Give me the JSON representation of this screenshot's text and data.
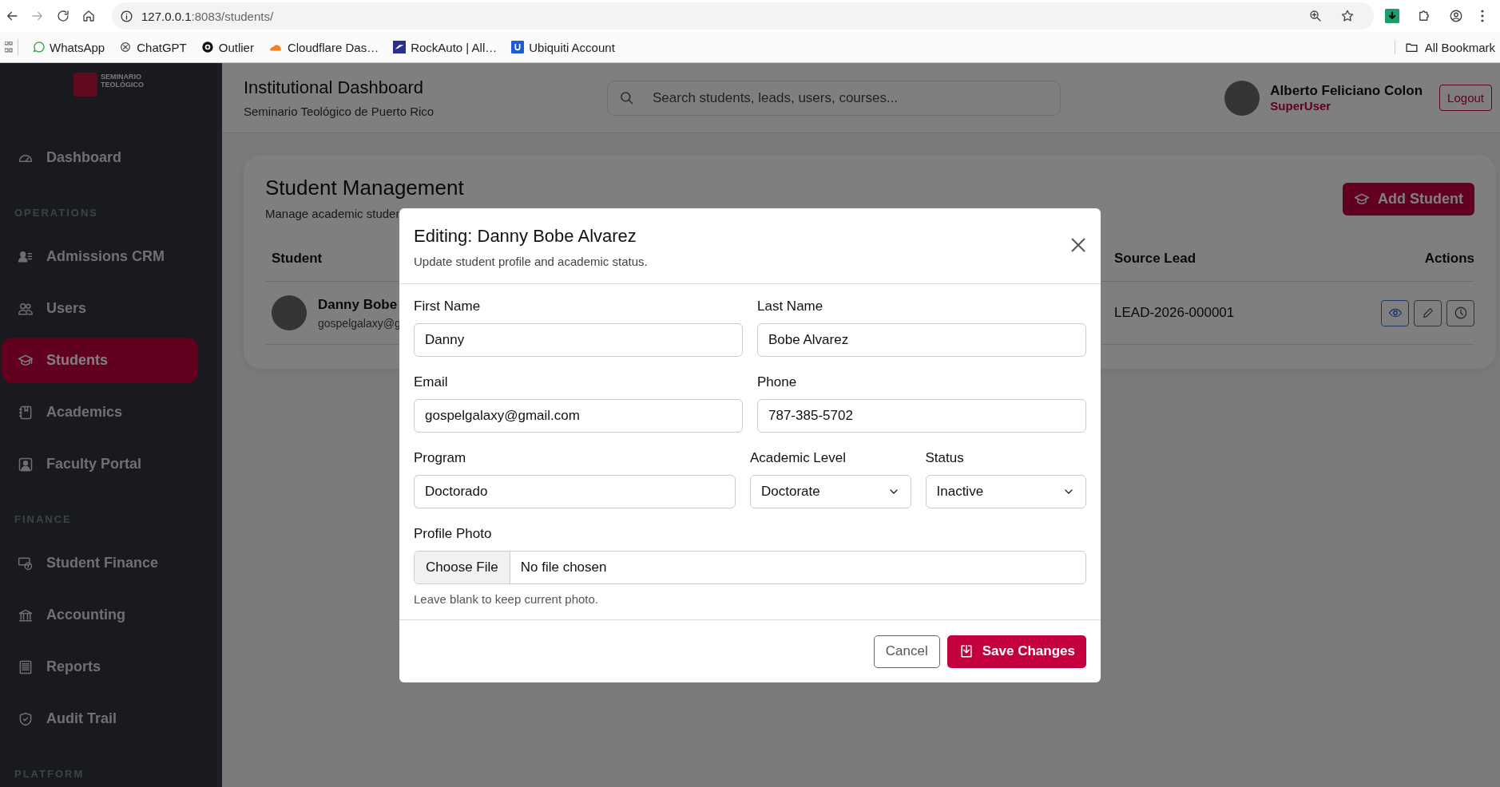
{
  "browser": {
    "url_host": "127.0.0.1",
    "url_path": ":8083/students/",
    "bookmarks": [
      {
        "label": "WhatsApp"
      },
      {
        "label": "ChatGPT"
      },
      {
        "label": "Outlier"
      },
      {
        "label": "Cloudflare Das…"
      },
      {
        "label": "RockAuto | All…"
      },
      {
        "label": "Ubiquiti Account"
      }
    ],
    "all_bookmarks": "All Bookmark"
  },
  "sidebar": {
    "logo_text": [
      "SEMINARIO",
      "TEOLÓGICO"
    ],
    "items": [
      {
        "kind": "link",
        "label": "Dashboard",
        "selected": false
      },
      {
        "kind": "section",
        "label": "OPERATIONS"
      },
      {
        "kind": "link",
        "label": "Admissions CRM",
        "selected": false
      },
      {
        "kind": "link",
        "label": "Users",
        "selected": false
      },
      {
        "kind": "link",
        "label": "Students",
        "selected": true
      },
      {
        "kind": "link",
        "label": "Academics",
        "selected": false
      },
      {
        "kind": "link",
        "label": "Faculty Portal",
        "selected": false
      },
      {
        "kind": "section",
        "label": "FINANCE"
      },
      {
        "kind": "link",
        "label": "Student Finance",
        "selected": false
      },
      {
        "kind": "link",
        "label": "Accounting",
        "selected": false
      },
      {
        "kind": "link",
        "label": "Reports",
        "selected": false
      },
      {
        "kind": "link",
        "label": "Audit Trail",
        "selected": false
      },
      {
        "kind": "section",
        "label": "PLATFORM"
      }
    ]
  },
  "header": {
    "title": "Institutional Dashboard",
    "subtitle": "Seminario Teológico de Puerto Rico",
    "search": {
      "placeholder": "Search students, leads, users, courses..."
    },
    "user": {
      "name": "Alberto Feliciano Colon",
      "role": "SuperUser"
    },
    "logout": "Logout"
  },
  "page": {
    "title": "Student Management",
    "subtitle": "Manage academic studen",
    "add_button": "Add Student",
    "table": {
      "columns": [
        "Student",
        "Source Lead",
        "Actions"
      ],
      "rows": [
        {
          "name": "Danny Bobe",
          "email": "gospelgalaxy@g",
          "source_lead": "LEAD-2026-000001"
        }
      ]
    }
  },
  "modal": {
    "title": "Editing: Danny Bobe Alvarez",
    "subtitle": "Update student profile and academic status.",
    "rows": [
      [
        {
          "kind": "text",
          "label": "First Name",
          "value": "Danny"
        },
        {
          "kind": "text",
          "label": "Last Name",
          "value": "Bobe Alvarez"
        }
      ],
      [
        {
          "kind": "text",
          "label": "Email",
          "value": "gospelgalaxy@gmail.com"
        },
        {
          "kind": "text",
          "label": "Phone",
          "value": "787-385-5702"
        }
      ],
      [
        {
          "kind": "text",
          "label": "Program",
          "value": "Doctorado"
        },
        {
          "kind": "select",
          "label": "Academic Level",
          "value": "Doctorate"
        },
        {
          "kind": "select",
          "label": "Status",
          "value": "Inactive"
        }
      ]
    ],
    "photo": {
      "label": "Profile Photo",
      "button": "Choose File",
      "status": "No file chosen",
      "hint": "Leave blank to keep current photo."
    },
    "cancel": "Cancel",
    "save": "Save Changes"
  }
}
